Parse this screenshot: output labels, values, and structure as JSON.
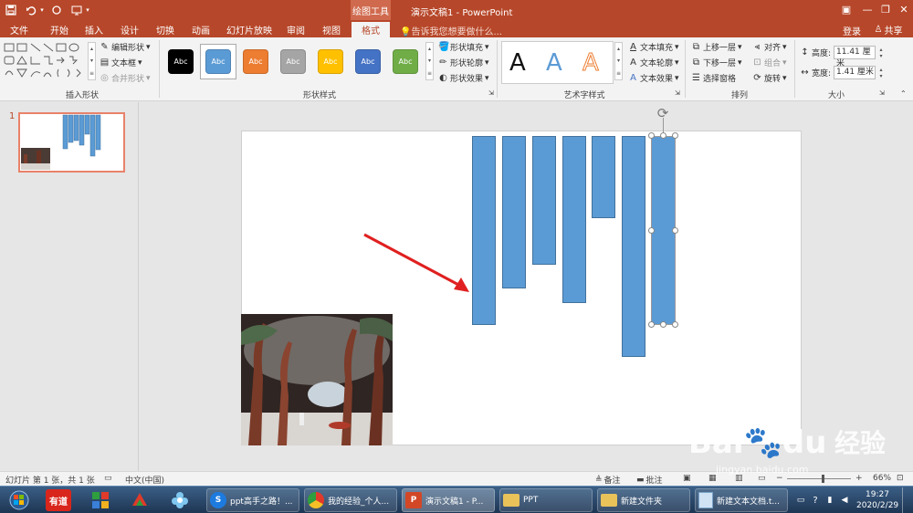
{
  "title_bar": {
    "contextual_tab": "绘图工具",
    "doc_title": "演示文稿1 - PowerPoint",
    "login": "登录",
    "share": "共享"
  },
  "tabs": [
    "文件",
    "开始",
    "插入",
    "设计",
    "切换",
    "动画",
    "幻灯片放映",
    "审阅",
    "视图",
    "格式"
  ],
  "active_tab": "格式",
  "tell_me": "告诉我您想要做什么...",
  "ribbon": {
    "insert_shapes": {
      "edit_shape": "编辑形状",
      "text_box": "文本框",
      "merge_shapes": "合并形状",
      "label": "插入形状"
    },
    "shape_styles": {
      "presets": [
        {
          "text": "Abc",
          "color": "#000000"
        },
        {
          "text": "Abc",
          "color": "#5b9bd5"
        },
        {
          "text": "Abc",
          "color": "#ed7d31"
        },
        {
          "text": "Abc",
          "color": "#a5a5a5"
        },
        {
          "text": "Abc",
          "color": "#ffc000"
        },
        {
          "text": "Abc",
          "color": "#4472c4"
        },
        {
          "text": "Abc",
          "color": "#70ad47"
        }
      ],
      "fill": "形状填充",
      "outline": "形状轮廓",
      "effects": "形状效果",
      "label": "形状样式"
    },
    "wordart": {
      "letters": [
        "A",
        "A",
        "A"
      ],
      "text_fill": "文本填充",
      "text_outline": "文本轮廓",
      "text_effects": "文本效果",
      "label": "艺术字样式"
    },
    "arrange": {
      "bring_forward": "上移一层",
      "send_backward": "下移一层",
      "selection_pane": "选择窗格",
      "align": "对齐",
      "group": "组合",
      "rotate": "旋转",
      "label": "排列"
    },
    "size": {
      "height_label": "高度:",
      "height_value": "11.41 厘米",
      "width_label": "宽度:",
      "width_value": "1.41 厘米",
      "label": "大小"
    }
  },
  "thumbnail_number": "1",
  "status_bar": {
    "slide_info": "幻灯片 第 1 张，共 1 张",
    "language": "中文(中国)",
    "notes": "备注",
    "comments": "批注",
    "zoom": "66%"
  },
  "taskbar": {
    "items": [
      {
        "name": "ppt-guide",
        "label": "ppt高手之路！..."
      },
      {
        "name": "my-experience",
        "label": "我的经验_个人..."
      },
      {
        "name": "powerpoint",
        "label": "演示文稿1 - P..."
      },
      {
        "name": "folder-ppt",
        "label": "PPT"
      },
      {
        "name": "new-folder",
        "label": "新建文件夹"
      },
      {
        "name": "notepad",
        "label": "新建文本文档.t..."
      }
    ],
    "youdao": "有道",
    "time": "19:27",
    "date": "2020/2/29"
  },
  "watermark": {
    "brand": "Bai",
    "brand2": "du",
    "jingyan": "经验",
    "url": "jingyan.baidu.com"
  },
  "colors": {
    "accent": "#b7472a",
    "shape_fill": "#5b9bd5",
    "shape_outline": "#41719c",
    "arrow": "#e02020"
  }
}
